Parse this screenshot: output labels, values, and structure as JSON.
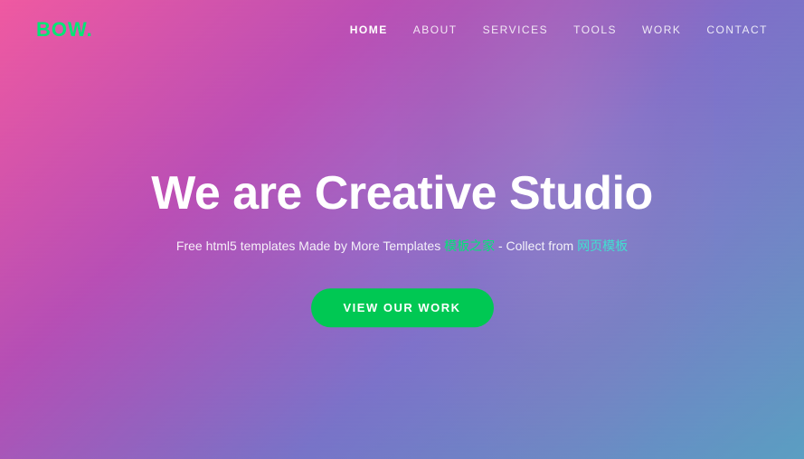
{
  "brand": {
    "name": "BOW",
    "dot": "."
  },
  "nav": {
    "links": [
      {
        "label": "HOME",
        "active": true,
        "id": "home"
      },
      {
        "label": "ABOUT",
        "active": false,
        "id": "about"
      },
      {
        "label": "SERVICES",
        "active": false,
        "id": "services"
      },
      {
        "label": "TOOLS",
        "active": false,
        "id": "tools"
      },
      {
        "label": "WORK",
        "active": false,
        "id": "work"
      },
      {
        "label": "CONTACT",
        "active": false,
        "id": "contact"
      }
    ]
  },
  "hero": {
    "title": "We are Creative Studio",
    "subtitle_part1": "Free html5 templates Made by More Templates ",
    "subtitle_link1": "模板之家",
    "subtitle_part2": " - Collect from ",
    "subtitle_link2": "网页模板",
    "cta_label": "VIEW OUR WORK"
  },
  "colors": {
    "accent_green": "#00c853",
    "accent_teal": "#40e0d0",
    "brand_dot": "#00e676"
  }
}
